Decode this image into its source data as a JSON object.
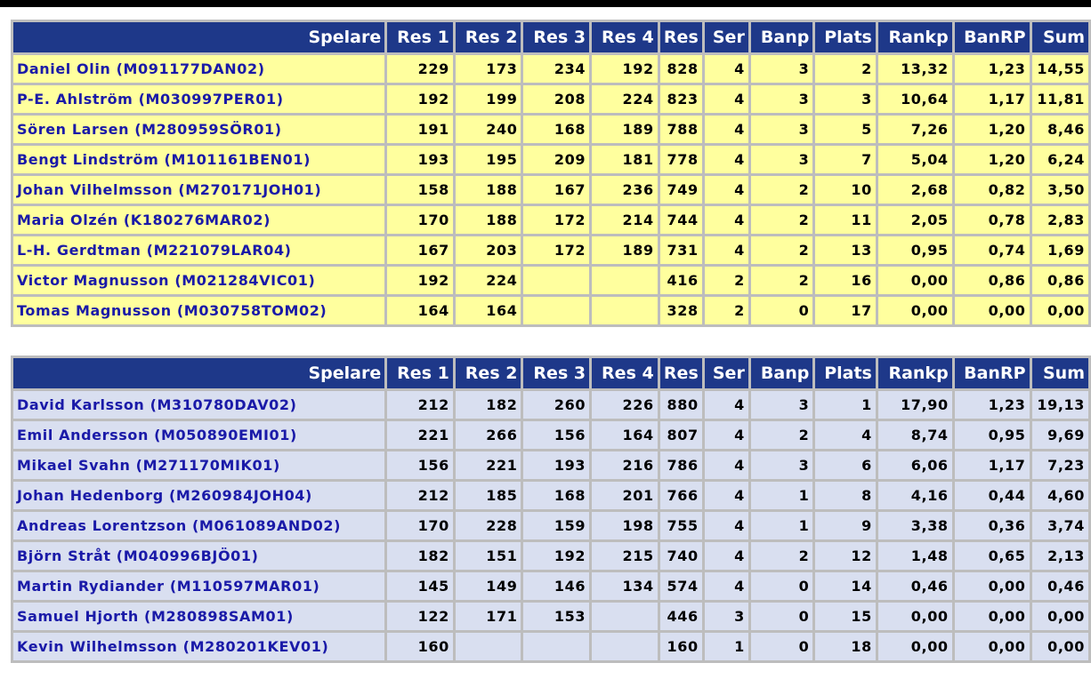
{
  "columns": [
    "Spelare",
    "Res 1",
    "Res 2",
    "Res 3",
    "Res 4",
    "Res",
    "Ser",
    "Banp",
    "Plats",
    "Rankp",
    "BanRP",
    "Sum"
  ],
  "colors": {
    "header_bg": "#1e3889",
    "table1_row_bg": "#ffff9e",
    "table2_row_bg": "#d9dff0",
    "name_text": "#1a1aa8",
    "border": "#bdbdbd"
  },
  "tables": [
    {
      "rows": [
        [
          "Daniel Olin (M091177DAN02)",
          "229",
          "173",
          "234",
          "192",
          "828",
          "4",
          "3",
          "2",
          "13,32",
          "1,23",
          "14,55"
        ],
        [
          "P-E. Ahlström (M030997PER01)",
          "192",
          "199",
          "208",
          "224",
          "823",
          "4",
          "3",
          "3",
          "10,64",
          "1,17",
          "11,81"
        ],
        [
          "Sören Larsen (M280959SÖR01)",
          "191",
          "240",
          "168",
          "189",
          "788",
          "4",
          "3",
          "5",
          "7,26",
          "1,20",
          "8,46"
        ],
        [
          "Bengt Lindström (M101161BEN01)",
          "193",
          "195",
          "209",
          "181",
          "778",
          "4",
          "3",
          "7",
          "5,04",
          "1,20",
          "6,24"
        ],
        [
          "Johan Vilhelmsson (M270171JOH01)",
          "158",
          "188",
          "167",
          "236",
          "749",
          "4",
          "2",
          "10",
          "2,68",
          "0,82",
          "3,50"
        ],
        [
          "Maria Olzén (K180276MAR02)",
          "170",
          "188",
          "172",
          "214",
          "744",
          "4",
          "2",
          "11",
          "2,05",
          "0,78",
          "2,83"
        ],
        [
          "L-H. Gerdtman (M221079LAR04)",
          "167",
          "203",
          "172",
          "189",
          "731",
          "4",
          "2",
          "13",
          "0,95",
          "0,74",
          "1,69"
        ],
        [
          "Victor Magnusson (M021284VIC01)",
          "192",
          "224",
          "",
          "",
          "416",
          "2",
          "2",
          "16",
          "0,00",
          "0,86",
          "0,86"
        ],
        [
          "Tomas Magnusson (M030758TOM02)",
          "164",
          "164",
          "",
          "",
          "328",
          "2",
          "0",
          "17",
          "0,00",
          "0,00",
          "0,00"
        ]
      ]
    },
    {
      "rows": [
        [
          "David Karlsson (M310780DAV02)",
          "212",
          "182",
          "260",
          "226",
          "880",
          "4",
          "3",
          "1",
          "17,90",
          "1,23",
          "19,13"
        ],
        [
          "Emil Andersson (M050890EMI01)",
          "221",
          "266",
          "156",
          "164",
          "807",
          "4",
          "2",
          "4",
          "8,74",
          "0,95",
          "9,69"
        ],
        [
          "Mikael Svahn (M271170MIK01)",
          "156",
          "221",
          "193",
          "216",
          "786",
          "4",
          "3",
          "6",
          "6,06",
          "1,17",
          "7,23"
        ],
        [
          "Johan Hedenborg (M260984JOH04)",
          "212",
          "185",
          "168",
          "201",
          "766",
          "4",
          "1",
          "8",
          "4,16",
          "0,44",
          "4,60"
        ],
        [
          "Andreas Lorentzson (M061089AND02)",
          "170",
          "228",
          "159",
          "198",
          "755",
          "4",
          "1",
          "9",
          "3,38",
          "0,36",
          "3,74"
        ],
        [
          "Björn Stråt (M040996BJÖ01)",
          "182",
          "151",
          "192",
          "215",
          "740",
          "4",
          "2",
          "12",
          "1,48",
          "0,65",
          "2,13"
        ],
        [
          "Martin Rydiander (M110597MAR01)",
          "145",
          "149",
          "146",
          "134",
          "574",
          "4",
          "0",
          "14",
          "0,46",
          "0,00",
          "0,46"
        ],
        [
          "Samuel Hjorth (M280898SAM01)",
          "122",
          "171",
          "153",
          "",
          "446",
          "3",
          "0",
          "15",
          "0,00",
          "0,00",
          "0,00"
        ],
        [
          "Kevin Wilhelmsson (M280201KEV01)",
          "160",
          "",
          "",
          "",
          "160",
          "1",
          "0",
          "18",
          "0,00",
          "0,00",
          "0,00"
        ]
      ]
    }
  ]
}
